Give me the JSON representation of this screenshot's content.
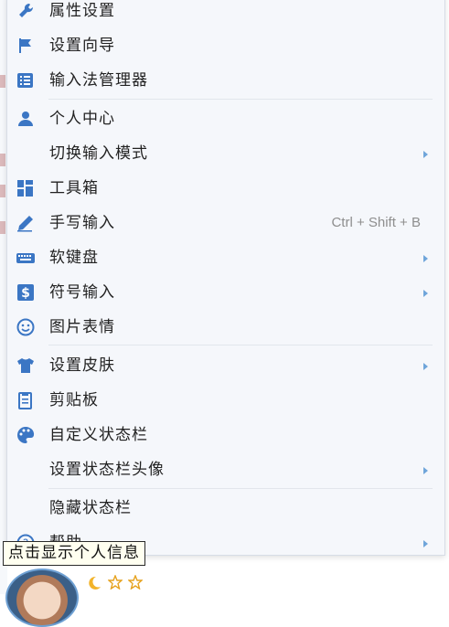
{
  "context_menu": {
    "items": [
      {
        "label": "属性设置",
        "icon": "wrench-icon"
      },
      {
        "label": "设置向导",
        "icon": "flag-icon"
      },
      {
        "label": "输入法管理器",
        "icon": "list-icon"
      },
      {
        "label": "个人中心",
        "icon": "user-icon"
      },
      {
        "label": "切换输入模式",
        "icon": ""
      },
      {
        "label": "工具箱",
        "icon": "grid-icon"
      },
      {
        "label": "手写输入",
        "icon": "pen-icon",
        "shortcut": "Ctrl + Shift + B"
      },
      {
        "label": "软键盘",
        "icon": "keyboard-icon"
      },
      {
        "label": "符号输入",
        "icon": "dollar-icon"
      },
      {
        "label": "图片表情",
        "icon": "smiley-icon"
      },
      {
        "label": "设置皮肤",
        "icon": "shirt-icon"
      },
      {
        "label": "剪贴板",
        "icon": "clipboard-icon"
      },
      {
        "label": "自定义状态栏",
        "icon": "palette-icon"
      },
      {
        "label": "设置状态栏头像",
        "icon": ""
      },
      {
        "label": "隐藏状态栏",
        "icon": ""
      },
      {
        "label": "帮助",
        "icon": "help-icon"
      }
    ]
  },
  "tooltip": {
    "text": "点击显示个人信息"
  },
  "colors": {
    "icon_blue": "#3b76c4",
    "menu_bg": "#f5f7fb",
    "arrow": "#6fa5da"
  }
}
